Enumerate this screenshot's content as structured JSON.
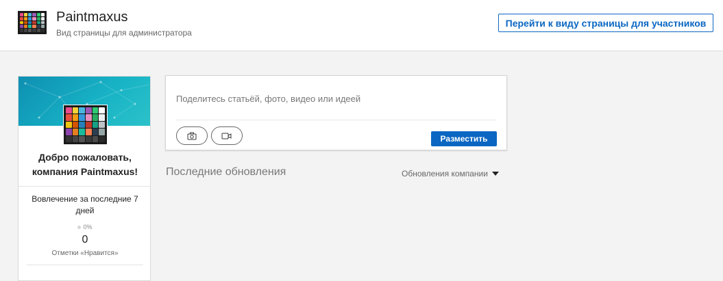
{
  "header": {
    "company_name": "Paintmaxus",
    "subtitle": "Вид страницы для администратора",
    "member_view_button": "Перейти к виду страницы для участников"
  },
  "colors": {
    "accent": "#0a66c2",
    "banner": "#18b4c6"
  },
  "profile_card": {
    "welcome": "Добро пожаловать, компания Paintmaxus!",
    "engagement_title": "Вовлечение за последние 7 дней",
    "likes_change": "0%",
    "likes_count": "0",
    "likes_label": "Отметки «Нравится»"
  },
  "composer": {
    "placeholder": "Поделитесь статьёй, фото, видео или идеей",
    "photo_icon": "camera-icon",
    "video_icon": "video-icon",
    "post_button": "Разместить"
  },
  "feed": {
    "title": "Последние обновления",
    "filter": "Обновления компании"
  }
}
